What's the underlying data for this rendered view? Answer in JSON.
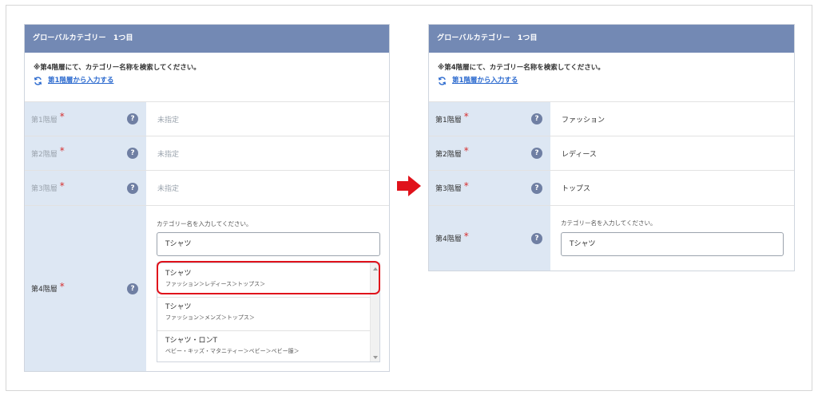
{
  "left_panel": {
    "header": "グローバルカテゴリー　1つ目",
    "notice": "※第4階層にて、カテゴリー名称を検索してください。",
    "link": "第1階層から入力する",
    "rows": [
      {
        "label": "第1階層",
        "value": "未指定"
      },
      {
        "label": "第2階層",
        "value": "未指定"
      },
      {
        "label": "第3階層",
        "value": "未指定"
      }
    ],
    "fourth": {
      "label": "第4階層",
      "hint": "カテゴリー名を入力してください。",
      "input_value": "Tシャツ",
      "suggestions": [
        {
          "title": "Tシャツ",
          "path": "ファッション＞レディース＞トップス＞"
        },
        {
          "title": "Tシャツ",
          "path": "ファッション＞メンズ＞トップス＞"
        },
        {
          "title": "Tシャツ・ロンT",
          "path": "ベビー・キッズ・マタニティー＞ベビー＞ベビー服＞"
        }
      ]
    }
  },
  "right_panel": {
    "header": "グローバルカテゴリー　1つ目",
    "notice": "※第4階層にて、カテゴリー名称を検索してください。",
    "link": "第1階層から入力する",
    "rows": [
      {
        "label": "第1階層",
        "value": "ファッション"
      },
      {
        "label": "第2階層",
        "value": "レディース"
      },
      {
        "label": "第3階層",
        "value": "トップス"
      }
    ],
    "fourth": {
      "label": "第4階層",
      "hint": "カテゴリー名を入力してください。",
      "input_value": "Tシャツ"
    }
  },
  "required_mark": "*",
  "help_mark": "?",
  "icons": {
    "refresh": "refresh-icon",
    "help": "help-icon",
    "arrow": "arrow-right-icon"
  },
  "colors": {
    "header_bg": "#7389b4",
    "label_bg": "#dde7f3",
    "link": "#2d6bcf",
    "required": "#d63030",
    "highlight": "#e0121b",
    "arrow": "#e0121b"
  }
}
